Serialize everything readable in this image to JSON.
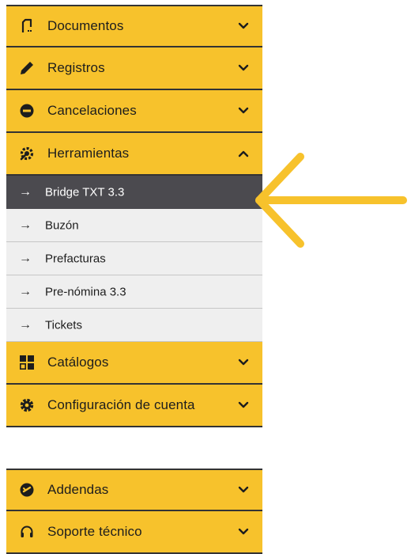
{
  "menu": {
    "sections": [
      {
        "label": "Documentos",
        "icon": "file-icon",
        "expanded": false
      },
      {
        "label": "Registros",
        "icon": "pencil-icon",
        "expanded": false
      },
      {
        "label": "Cancelaciones",
        "icon": "minus-circle-icon",
        "expanded": false
      },
      {
        "label": "Herramientas",
        "icon": "tools-gear-icon",
        "expanded": true
      },
      {
        "label": "Catálogos",
        "icon": "grid-icon",
        "expanded": false
      },
      {
        "label": "Configuración de cuenta",
        "icon": "gear-icon",
        "expanded": false
      }
    ],
    "herramientas_items": [
      {
        "label": "Bridge TXT 3.3",
        "active": true
      },
      {
        "label": "Buzón",
        "active": false
      },
      {
        "label": "Prefacturas",
        "active": false
      },
      {
        "label": "Pre-nómina 3.3",
        "active": false
      },
      {
        "label": "Tickets",
        "active": false
      }
    ],
    "arrow_glyph": "→"
  },
  "secondary_menu": {
    "sections": [
      {
        "label": "Addendas",
        "icon": "check-circle-icon",
        "expanded": false
      },
      {
        "label": "Soporte técnico",
        "icon": "headset-icon",
        "expanded": false
      }
    ]
  },
  "colors": {
    "section_bg": "#f7c22c",
    "active_item_bg": "#4b4a4f",
    "submenu_bg": "#efefef",
    "pointer_arrow": "#f7c22c"
  }
}
